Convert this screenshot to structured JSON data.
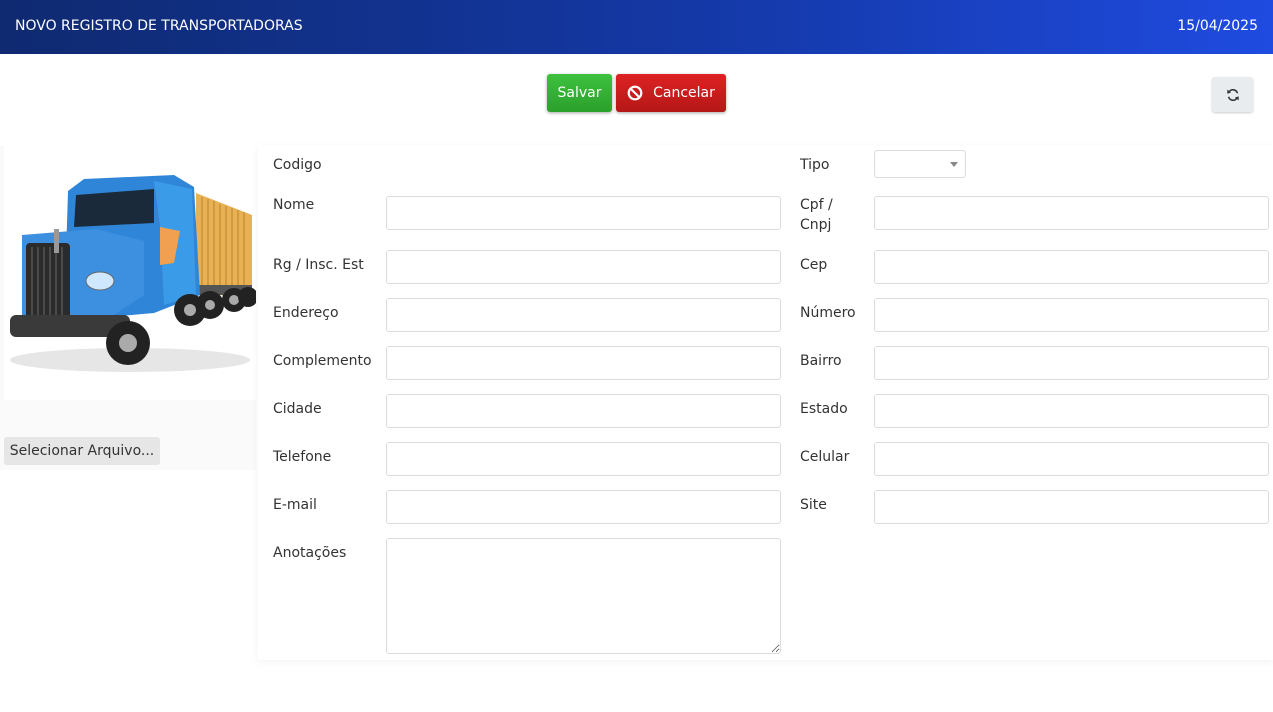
{
  "header": {
    "title": "NOVO REGISTRO DE TRANSPORTADORAS",
    "date": "15/04/2025"
  },
  "toolbar": {
    "save_label": "Salvar",
    "cancel_label": "Cancelar",
    "cancel_icon": "ban-icon",
    "refresh_icon": "refresh-icon",
    "save_color": "#2ba02b",
    "cancel_color": "#b51717"
  },
  "image_panel": {
    "file_button_label": "Selecionar Arquivo..."
  },
  "form": {
    "codigo_label": "Codigo",
    "tipo_label": "Tipo",
    "tipo_value": "",
    "nome_label": "Nome",
    "cpf_label_1": "Cpf /",
    "cpf_label_2": "Cnpj",
    "rg_label": "Rg / Insc. Est",
    "cep_label": "Cep",
    "endereco_label": "Endereço",
    "numero_label": "Número",
    "complemento_label": "Complemento",
    "bairro_label": "Bairro",
    "cidade_label": "Cidade",
    "estado_label": "Estado",
    "telefone_label": "Telefone",
    "celular_label": "Celular",
    "email_label": "E-mail",
    "site_label": "Site",
    "anotacoes_label": "Anotações"
  }
}
